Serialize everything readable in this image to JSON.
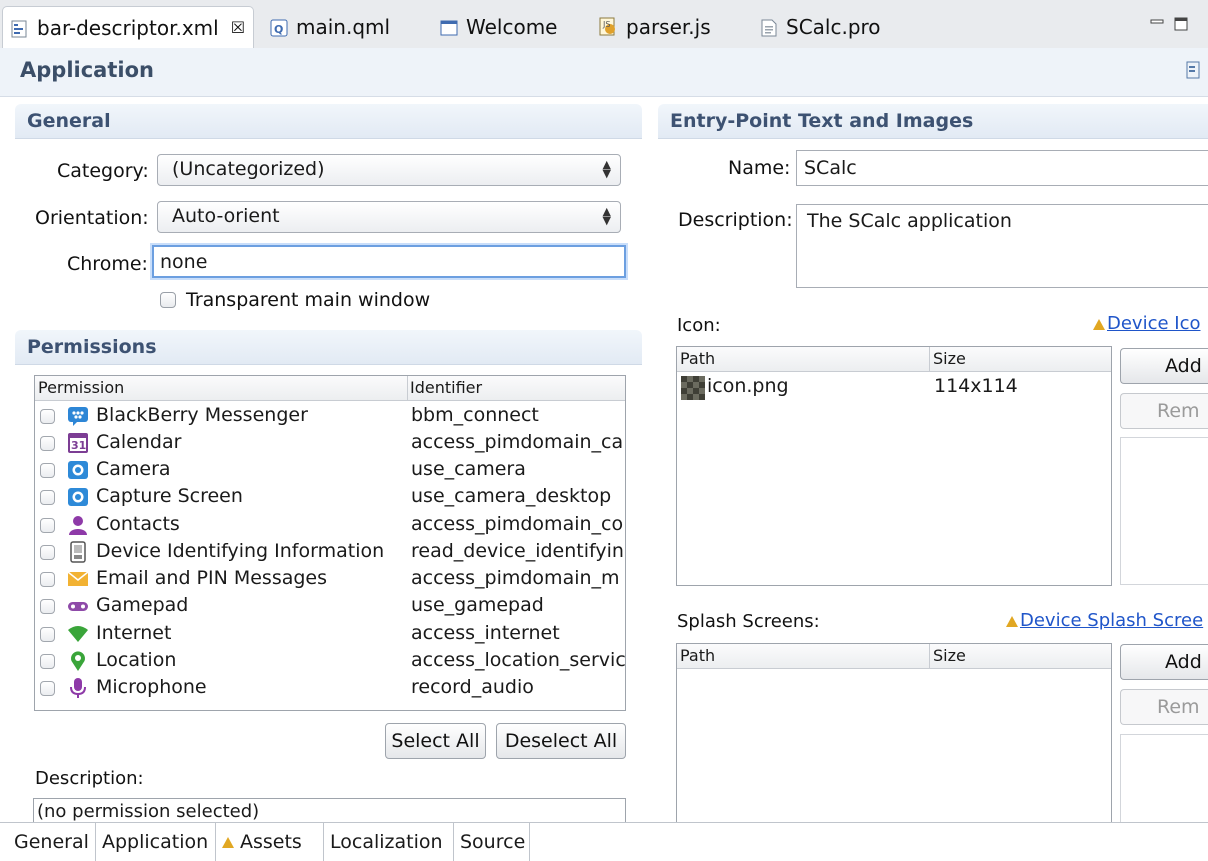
{
  "tabs": [
    {
      "label": "bar-descriptor.xml",
      "icon": "xml-file-icon",
      "active": true,
      "close": "☒"
    },
    {
      "label": "main.qml",
      "icon": "qml-file-icon"
    },
    {
      "label": "Welcome",
      "icon": "welcome-window-icon"
    },
    {
      "label": "parser.js",
      "icon": "js-file-icon"
    },
    {
      "label": "SCalc.pro",
      "icon": "pro-file-icon"
    }
  ],
  "header": {
    "title": "Application"
  },
  "general": {
    "title": "General",
    "category_label": "Category:",
    "category_value": "(Uncategorized)",
    "orientation_label": "Orientation:",
    "orientation_value": "Auto-orient",
    "chrome_label": "Chrome:",
    "chrome_value": "none",
    "transparent_label": "Transparent main window"
  },
  "permissions": {
    "title": "Permissions",
    "col_permission": "Permission",
    "col_identifier": "Identifier",
    "items": [
      {
        "name": "BlackBerry Messenger",
        "id": "bbm_connect",
        "icon": "bbm-icon"
      },
      {
        "name": "Calendar",
        "id": "access_pimdomain_ca",
        "icon": "calendar-icon"
      },
      {
        "name": "Camera",
        "id": "use_camera",
        "icon": "camera-icon"
      },
      {
        "name": "Capture Screen",
        "id": "use_camera_desktop",
        "icon": "capture-screen-icon"
      },
      {
        "name": "Contacts",
        "id": "access_pimdomain_co",
        "icon": "contacts-icon"
      },
      {
        "name": "Device Identifying Information",
        "id": "read_device_identifyin",
        "icon": "device-icon"
      },
      {
        "name": "Email and PIN Messages",
        "id": "access_pimdomain_m",
        "icon": "email-icon"
      },
      {
        "name": "Gamepad",
        "id": "use_gamepad",
        "icon": "gamepad-icon"
      },
      {
        "name": "Internet",
        "id": "access_internet",
        "icon": "internet-icon"
      },
      {
        "name": "Location",
        "id": "access_location_servic",
        "icon": "location-icon"
      },
      {
        "name": "Microphone",
        "id": "record_audio",
        "icon": "microphone-icon"
      }
    ],
    "select_all": "Select All",
    "deselect_all": "Deselect All",
    "description_label": "Description:",
    "description_value": "(no permission selected)"
  },
  "entry": {
    "title": "Entry-Point Text and Images",
    "name_label": "Name:",
    "name_value": "SCalc",
    "description_label": "Description:",
    "description_value": "The SCalc application",
    "icon_label": "Icon:",
    "device_icons_link": "Device Ico",
    "col_path": "Path",
    "col_size": "Size",
    "icon_rows": [
      {
        "path": "icon.png",
        "size": "114x114"
      }
    ],
    "add_label": "Add",
    "remove_label": "Rem",
    "splash_label": "Splash Screens:",
    "device_splash_link": "Device Splash Scree"
  },
  "bottom_tabs": [
    {
      "label": "General"
    },
    {
      "label": "Application",
      "active": true
    },
    {
      "label": "Assets",
      "warning": true
    },
    {
      "label": "Localization"
    },
    {
      "label": "Source"
    }
  ]
}
